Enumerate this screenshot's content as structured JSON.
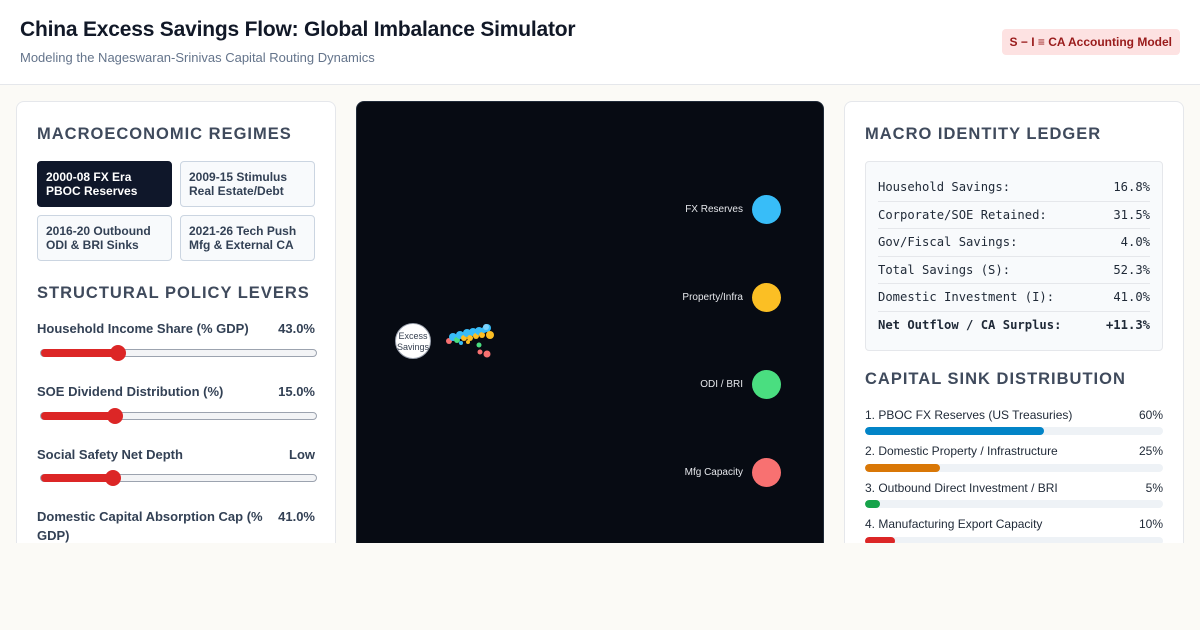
{
  "header": {
    "title": "China Excess Savings Flow: Global Imbalance Simulator",
    "subtitle": "Modeling the Nageswaran-Srinivas Capital Routing Dynamics",
    "badge": "S − I ≡ CA Accounting Model"
  },
  "left_panel": {
    "regimes_title": "MACROECONOMIC REGIMES",
    "regimes": [
      {
        "line1": "2000-08 FX Era",
        "line2": "PBOC Reserves",
        "active": true
      },
      {
        "line1": "2009-15 Stimulus",
        "line2": "Real Estate/Debt",
        "active": false
      },
      {
        "line1": "2016-20 Outbound",
        "line2": "ODI & BRI Sinks",
        "active": false
      },
      {
        "line1": "2021-26 Tech Push",
        "line2": "Mfg & External CA",
        "active": false
      }
    ],
    "levers_title": "STRUCTURAL POLICY LEVERS",
    "levers": [
      {
        "label": "Household Income Share (% GDP)",
        "value": "43.0%",
        "position": 0.28
      },
      {
        "label": "SOE Dividend Distribution (%)",
        "value": "15.0%",
        "position": 0.27
      },
      {
        "label": "Social Safety Net Depth",
        "value": "Low",
        "position": 0.26
      },
      {
        "label": "Domestic Capital Absorption Cap (% GDP)",
        "value": "41.0%"
      }
    ]
  },
  "canvas": {
    "source_label": "Excess Savings",
    "sinks": [
      {
        "label": "FX Reserves",
        "color": "#38bdf8"
      },
      {
        "label": "Property/Infra",
        "color": "#fbbf24"
      },
      {
        "label": "ODI / BRI",
        "color": "#4ade80"
      },
      {
        "label": "Mfg Capacity",
        "color": "#f87171"
      }
    ]
  },
  "right_panel": {
    "ledger_title": "MACRO IDENTITY LEDGER",
    "ledger": [
      {
        "label": "Household Savings:",
        "value": "16.8%"
      },
      {
        "label": "Corporate/SOE Retained:",
        "value": "31.5%"
      },
      {
        "label": "Gov/Fiscal Savings:",
        "value": "4.0%"
      },
      {
        "label": "Total Savings (S):",
        "value": "52.3%"
      },
      {
        "label": "Domestic Investment (I):",
        "value": "41.0%"
      },
      {
        "label": "Net Outflow / CA Surplus:",
        "value": "+11.3%"
      }
    ],
    "sinks_title": "CAPITAL SINK DISTRIBUTION",
    "sinks": [
      {
        "label": "1. PBOC FX Reserves (US Treasuries)",
        "pct": "60%",
        "share": 60,
        "color": "#0284c7"
      },
      {
        "label": "2. Domestic Property / Infrastructure",
        "pct": "25%",
        "share": 25,
        "color": "#d97706"
      },
      {
        "label": "3. Outbound Direct Investment / BRI",
        "pct": "5%",
        "share": 5,
        "color": "#16a34a"
      },
      {
        "label": "4. Manufacturing Export Capacity",
        "pct": "10%",
        "share": 10,
        "color": "#dc2626"
      }
    ]
  }
}
